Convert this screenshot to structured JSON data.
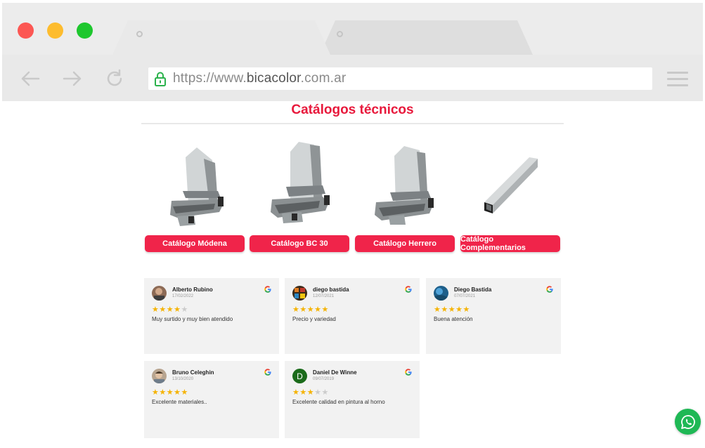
{
  "browser": {
    "url_prefix": "https://www.",
    "url_domain": "bicacolor",
    "url_suffix": ".com.ar"
  },
  "section": {
    "title": "Catálogos técnicos"
  },
  "catalogs": [
    {
      "label": "Catálogo Módena",
      "image": "modena-window-profile"
    },
    {
      "label": "Catálogo BC 30",
      "image": "bc30-window-profile"
    },
    {
      "label": "Catálogo Herrero",
      "image": "herrero-window-profile"
    },
    {
      "label": "Catálogo Complementarios",
      "image": "aluminum-tube"
    }
  ],
  "reviews": [
    {
      "name": "Alberto Rubino",
      "date": "17/02/2022",
      "rating": 4,
      "text": "Muy surtido y muy bien atendido"
    },
    {
      "name": "diego bastida",
      "date": "12/07/2021",
      "rating": 5,
      "text": "Precio y variedad"
    },
    {
      "name": "Diego Bastida",
      "date": "07/07/2021",
      "rating": 5,
      "text": "Buena atención"
    },
    {
      "name": "Bruno Celeghin",
      "date": "13/10/2020",
      "rating": 5,
      "text": "Excelente materiales.."
    },
    {
      "name": "Daniel De Winne",
      "date": "09/07/2019",
      "rating": 3,
      "text": "Excelente calidad en pintura al horno",
      "avatar_letter": "D"
    }
  ],
  "colors": {
    "accent": "#e8193c",
    "button": "#f0244a",
    "star": "#f5b301",
    "whatsapp": "#1fb855"
  },
  "icons": {
    "back": "arrow-left-icon",
    "forward": "arrow-right-icon",
    "reload": "reload-icon",
    "secure": "lock-icon",
    "menu": "hamburger-icon",
    "review_source": "google-icon",
    "chat": "whatsapp-icon"
  }
}
